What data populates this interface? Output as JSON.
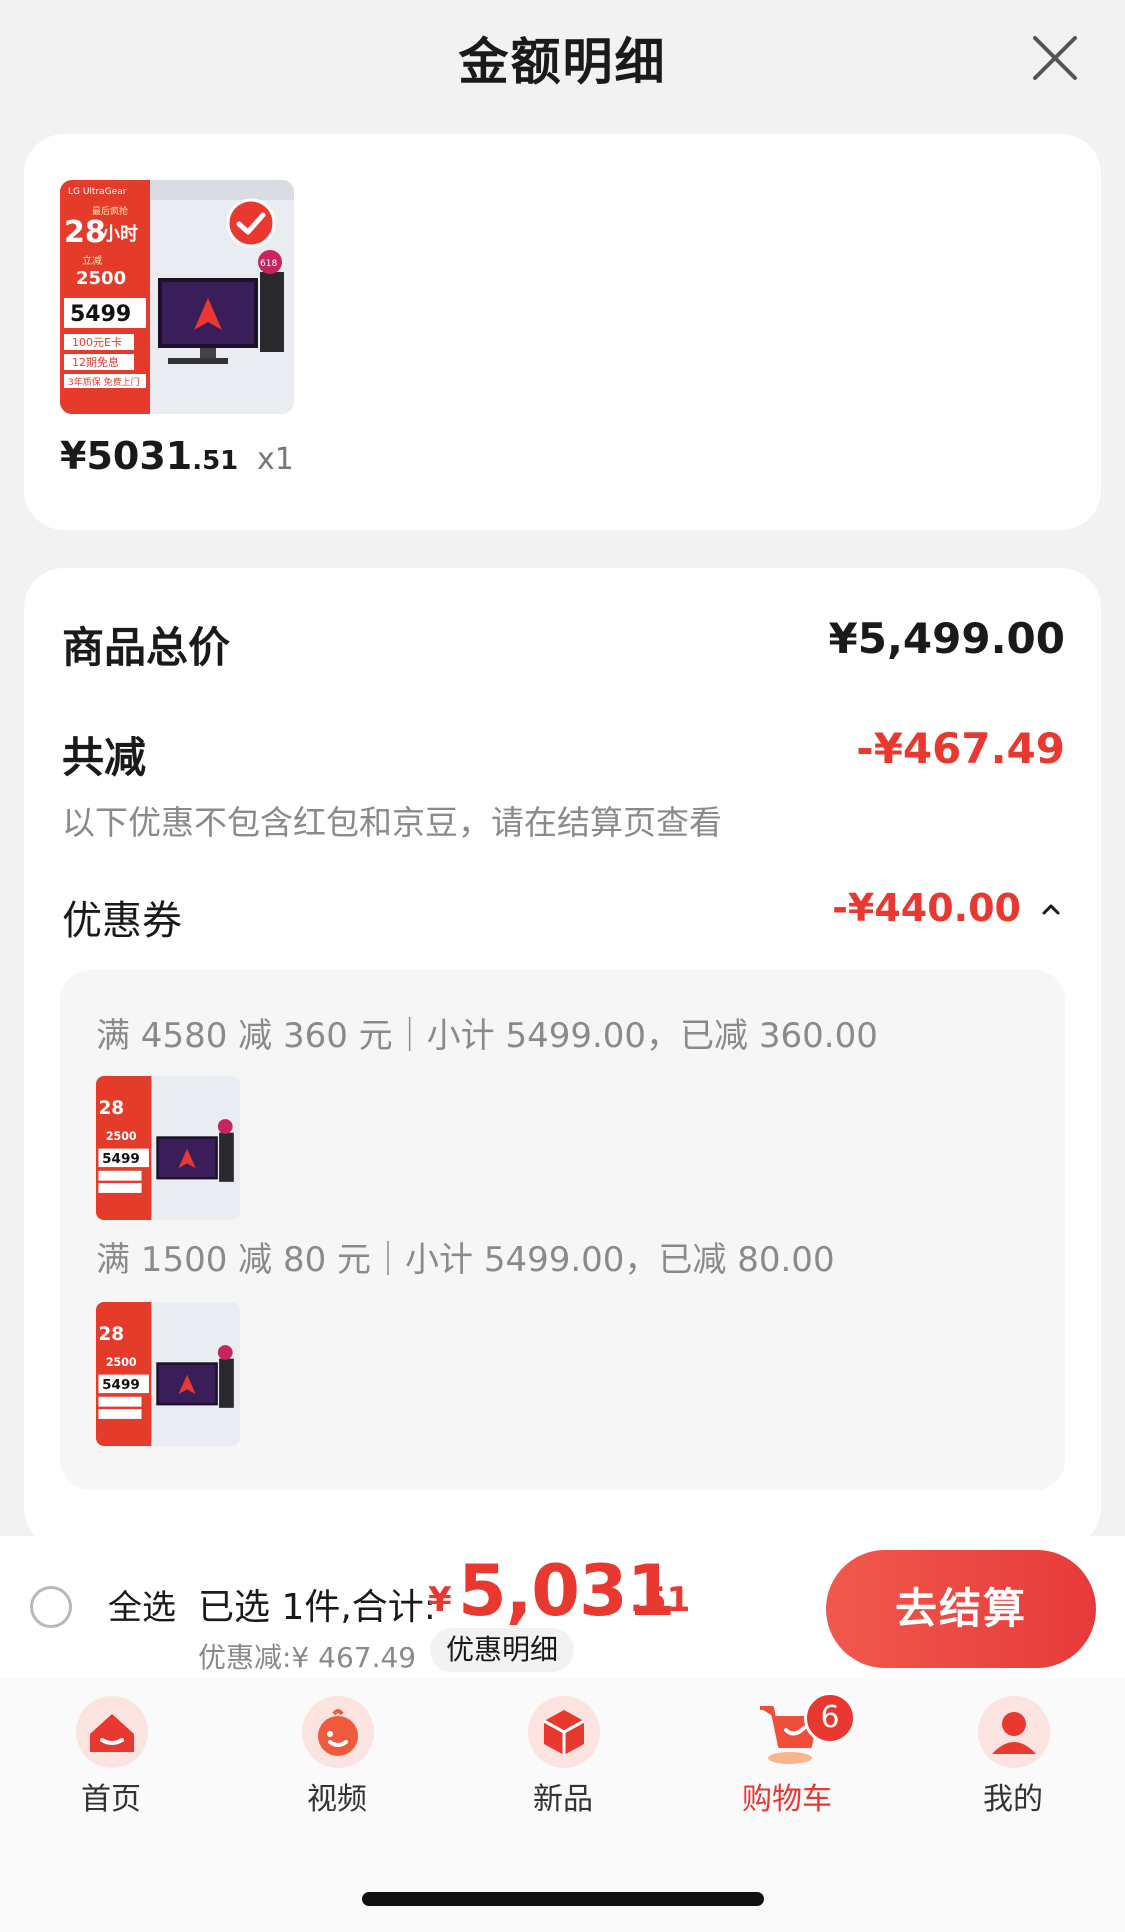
{
  "header": {
    "title": "金额明细",
    "close_icon": "close-icon"
  },
  "product": {
    "price_int": "¥5031",
    "price_dec": ".51",
    "quantity": "x1",
    "image": {
      "brand": "LG UltraGear",
      "promo_hours": "28",
      "promo_unit": "小时",
      "promo_top": "最后疯抢",
      "discount_tag": "立减",
      "discount_amount": "2500",
      "price": "5499",
      "perk1": "100元E卡",
      "perk2": "12期免息",
      "perk3": "3年质保 免费上门",
      "badge": "618"
    },
    "selected": true
  },
  "summary": {
    "total_label": "商品总价",
    "total_value": "¥5,499.00",
    "reduce_label": "共减",
    "reduce_value": "-¥467.49",
    "note": "以下优惠不包含红包和京豆，请在结算页查看",
    "coupon_label": "优惠券",
    "coupon_value": "-¥440.00"
  },
  "coupons": [
    {
      "rule": "满 4580 减 360 元｜小计 5499.00，已减 360.00"
    },
    {
      "rule": "满 1500 减 80 元｜小计 5499.00，已减 80.00"
    }
  ],
  "checkout": {
    "select_all": "全选",
    "selected_info": "已选 1件,合计:",
    "currency": "¥",
    "total_int": "5,031",
    "total_dec": ".51",
    "discount_text": "优惠减:¥ 467.49",
    "discount_detail": "优惠明细",
    "checkout_button": "去结算"
  },
  "tabs": [
    {
      "label": "首页",
      "icon": "home-icon"
    },
    {
      "label": "视频",
      "icon": "video-icon"
    },
    {
      "label": "新品",
      "icon": "new-products-icon"
    },
    {
      "label": "购物车",
      "icon": "cart-icon",
      "badge": "6",
      "active": true
    },
    {
      "label": "我的",
      "icon": "profile-icon"
    }
  ],
  "colors": {
    "accent": "#e8382f",
    "background": "#f2f2f2"
  }
}
